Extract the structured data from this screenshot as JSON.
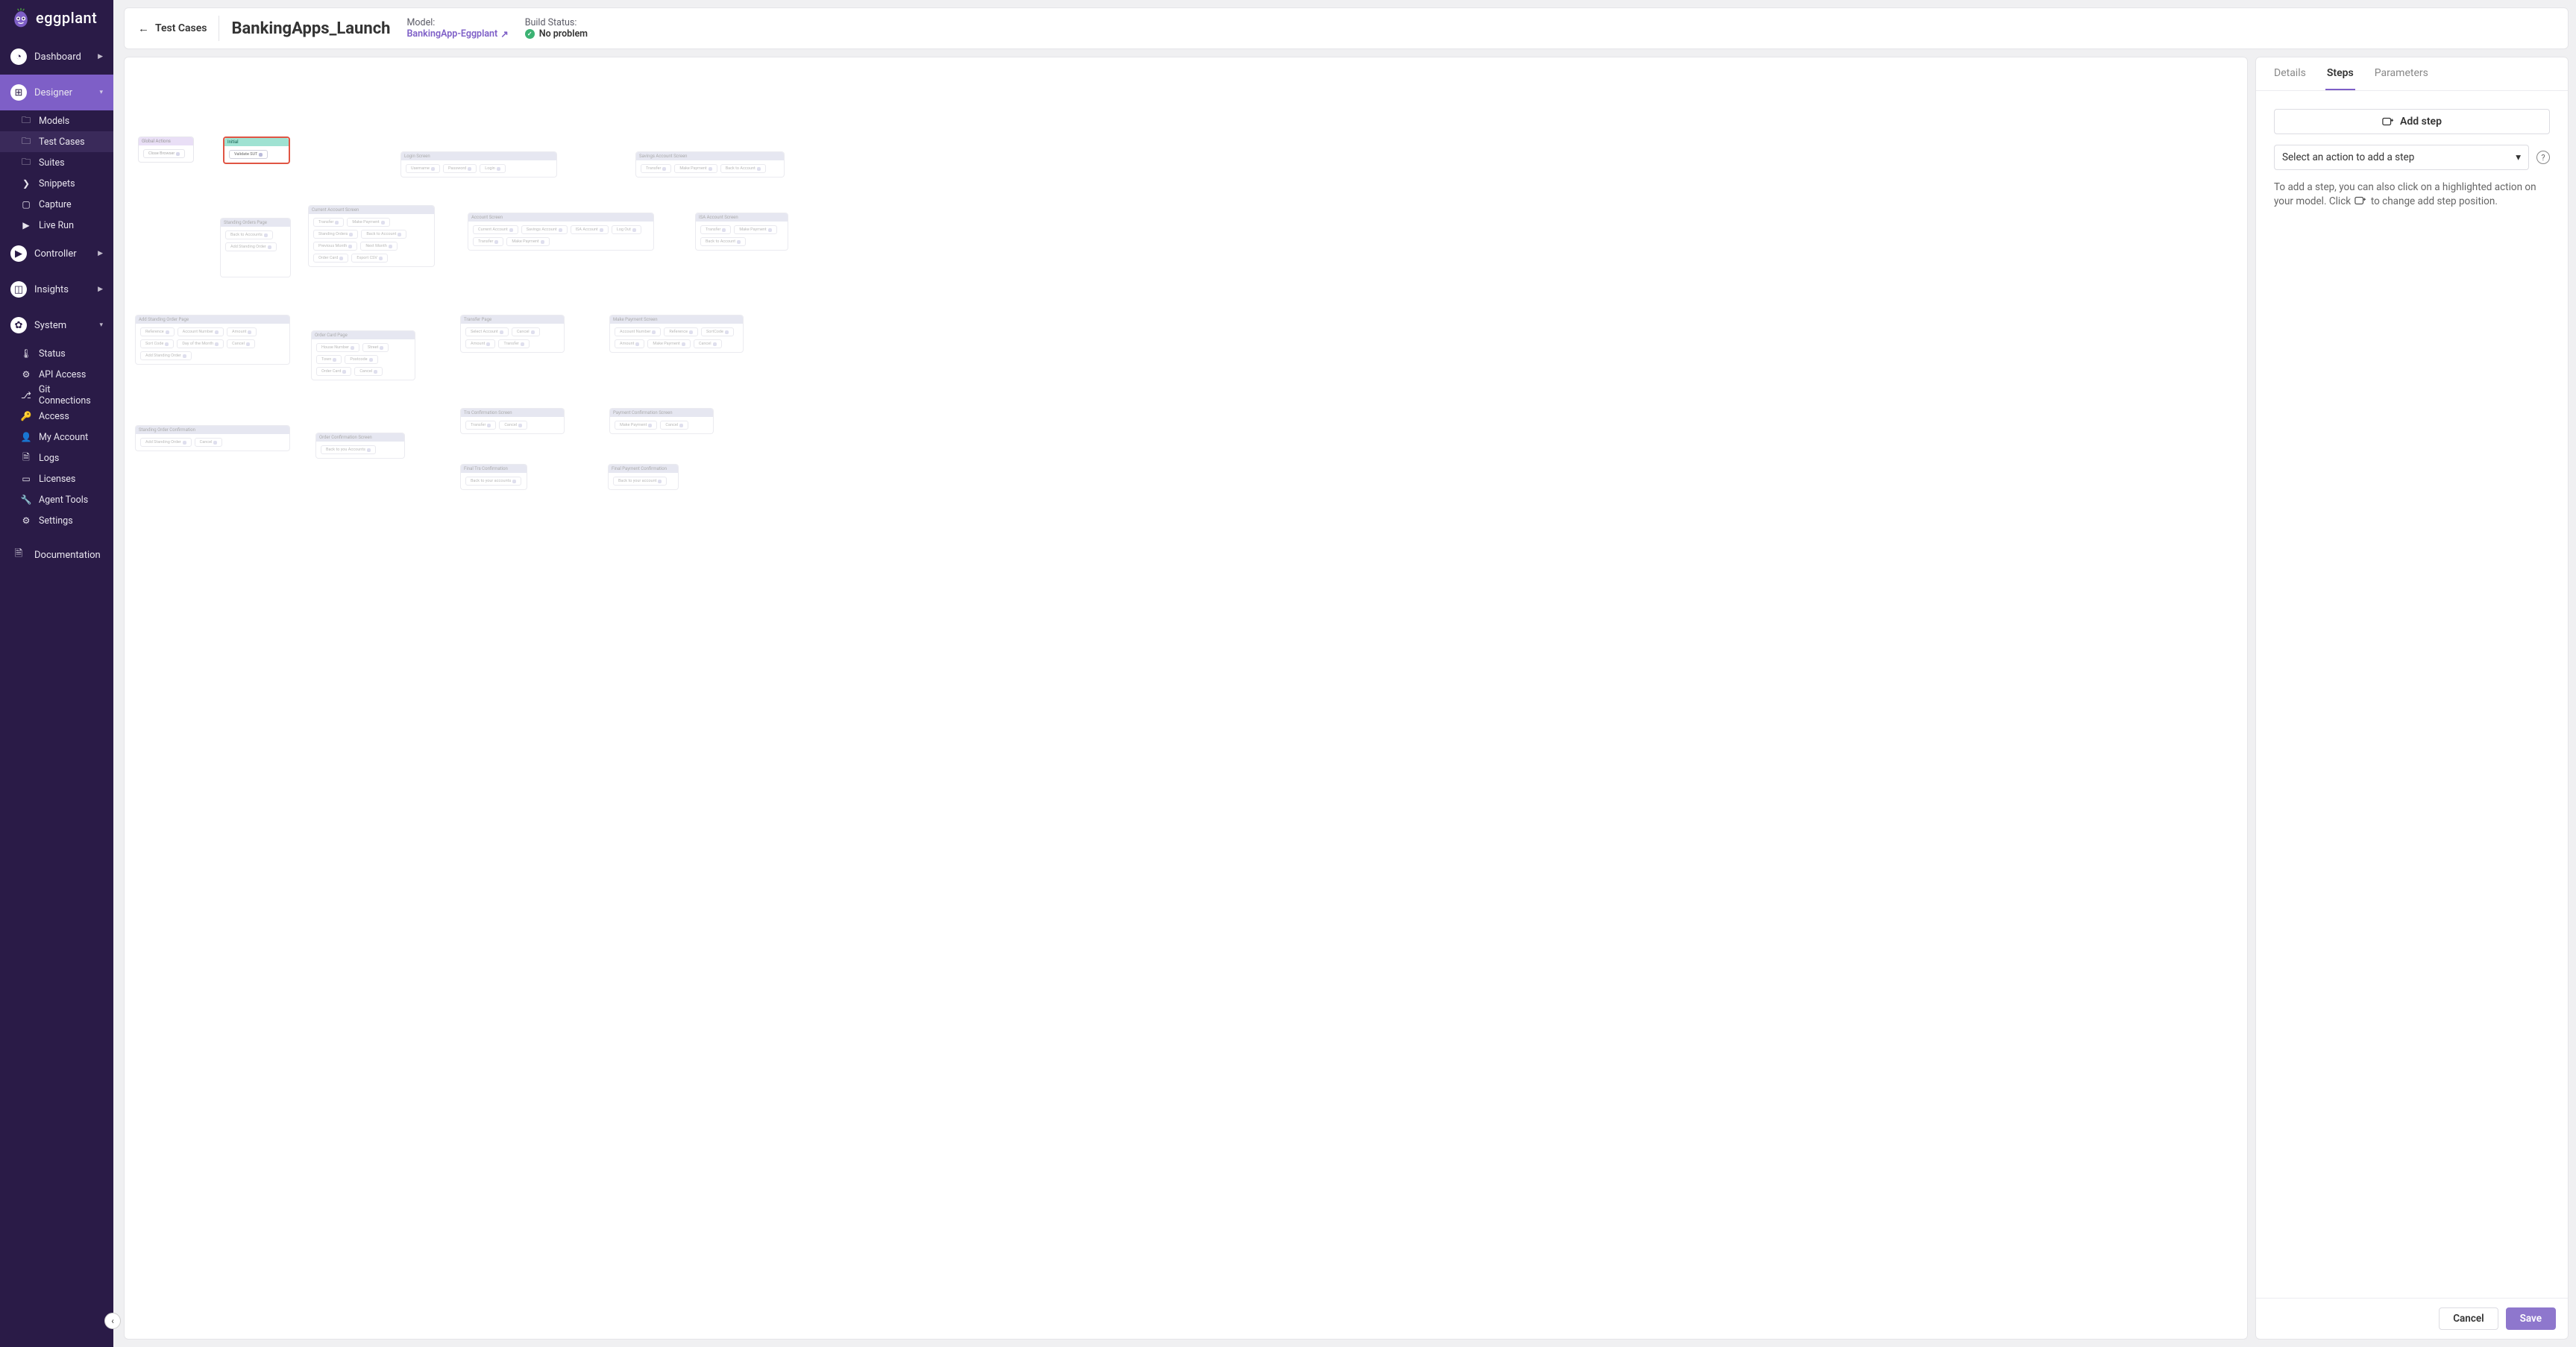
{
  "brand": "eggplant",
  "nav": {
    "dashboard": "Dashboard",
    "designer": "Designer",
    "models": "Models",
    "test_cases": "Test Cases",
    "suites": "Suites",
    "snippets": "Snippets",
    "capture": "Capture",
    "live_run": "Live Run",
    "controller": "Controller",
    "insights": "Insights",
    "system": "System",
    "status": "Status",
    "api_access": "API Access",
    "git_connections": "Git Connections",
    "access": "Access",
    "my_account": "My Account",
    "logs": "Logs",
    "licenses": "Licenses",
    "agent_tools": "Agent Tools",
    "settings": "Settings",
    "documentation": "Documentation"
  },
  "breadcrumb": "Test Cases",
  "title": "BankingApps_Launch",
  "meta": {
    "model_label": "Model:",
    "model_name": "BankingApp-Eggplant",
    "build_label": "Build Status:",
    "build_value": "No problem"
  },
  "panel": {
    "tabs": {
      "details": "Details",
      "steps": "Steps",
      "parameters": "Parameters"
    },
    "add_step": "Add step",
    "select_placeholder": "Select an action to add a step",
    "hint_a": "To add a step, you can also click on a highlighted action on your model. Click ",
    "hint_b": " to change add step position.",
    "cancel": "Cancel",
    "save": "Save"
  },
  "nodes": {
    "global_actions": {
      "title": "Global Actions",
      "acts": [
        "Close Browser"
      ]
    },
    "initial": {
      "title": "Initial",
      "acts": [
        "Validate SUT"
      ]
    },
    "login_screen": {
      "title": "Login Screen",
      "acts": [
        "Username",
        "Password",
        "Login"
      ]
    },
    "savings_account_screen": {
      "title": "Savings Account Screen",
      "acts": [
        "Transfer",
        "Make Payment",
        "Back to Account"
      ]
    },
    "current_account_screen": {
      "title": "Current Account Screen",
      "acts": [
        "Transfer",
        "Make Payment",
        "Standing Orders",
        "Back to Account",
        "Previous Month",
        "Next Month",
        "Order Card",
        "Export CSV"
      ]
    },
    "standing_orders_page": {
      "title": "Standing Orders Page",
      "acts": [
        "Back to Accounts",
        "Add Standing Order"
      ]
    },
    "account_screen": {
      "title": "Account Screen",
      "acts": [
        "Current Account",
        "Savings Account",
        "ISA Account",
        "Log Out",
        "Transfer",
        "Make Payment"
      ]
    },
    "isa_account_screen": {
      "title": "ISA Account Screen",
      "acts": [
        "Transfer",
        "Make Payment",
        "Back to Account"
      ]
    },
    "add_standing_order_page": {
      "title": "Add Standing Order Page",
      "acts": [
        "Reference",
        "Account Number",
        "Amount",
        "Sort Code",
        "Day of the Month",
        "Cancel",
        "Add Standing Order"
      ]
    },
    "order_card_page": {
      "title": "Order Card Page",
      "acts": [
        "House Number",
        "Street",
        "Town",
        "Postcode",
        "Order Card",
        "Cancel"
      ]
    },
    "transfer_page": {
      "title": "Transfer Page",
      "acts": [
        "Select Account",
        "Cancel",
        "Amount",
        "Transfer"
      ]
    },
    "make_payment_screen": {
      "title": "Make Payment Screen",
      "acts": [
        "Account Number",
        "Reference",
        "SortCode",
        "Amount",
        "Make Payment",
        "Cancel"
      ]
    },
    "trs_confirmation_screen": {
      "title": "Trs Confirmation Screen",
      "acts": [
        "Transfer",
        "Cancel"
      ]
    },
    "payment_confirmation_screen": {
      "title": "Payment Confirmation Screen",
      "acts": [
        "Make Payment",
        "Cancel"
      ]
    },
    "standing_order_confirmation": {
      "title": "Standing Order Confirmation",
      "acts": [
        "Add Standing Order",
        "Cancel"
      ]
    },
    "order_confirmation_screen": {
      "title": "Order Confirmation Screen",
      "acts": [
        "Back to you Accounts"
      ]
    },
    "final_trs_confirmation": {
      "title": "Final Trs Confirmation",
      "acts": [
        "Back to your accounts"
      ]
    },
    "final_payment_confirmation": {
      "title": "Final Payment Confirmation",
      "acts": [
        "Back to your account"
      ]
    }
  }
}
